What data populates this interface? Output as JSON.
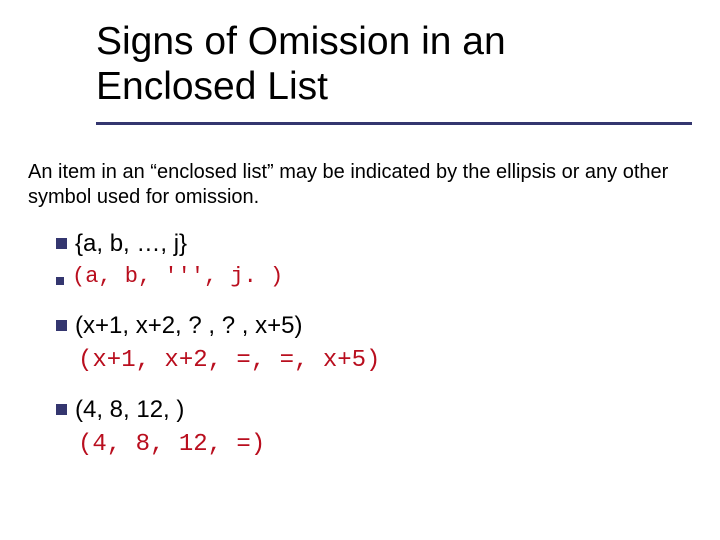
{
  "title": "Signs of Omission in an Enclosed List",
  "intro": "An item in an “enclosed list” may be indicated by the ellipsis or any other symbol used for omission.",
  "ex1": {
    "text": "{a, b, …, j}",
    "code": "(a, b, ''', j. )"
  },
  "ex2": {
    "text": "(x+1, x+2, ? , ? , x+5)",
    "code": "(x+1, x+2, =, =, x+5)"
  },
  "ex3": {
    "text": "(4, 8, 12,     )",
    "code": "(4, 8, 12, =)"
  }
}
